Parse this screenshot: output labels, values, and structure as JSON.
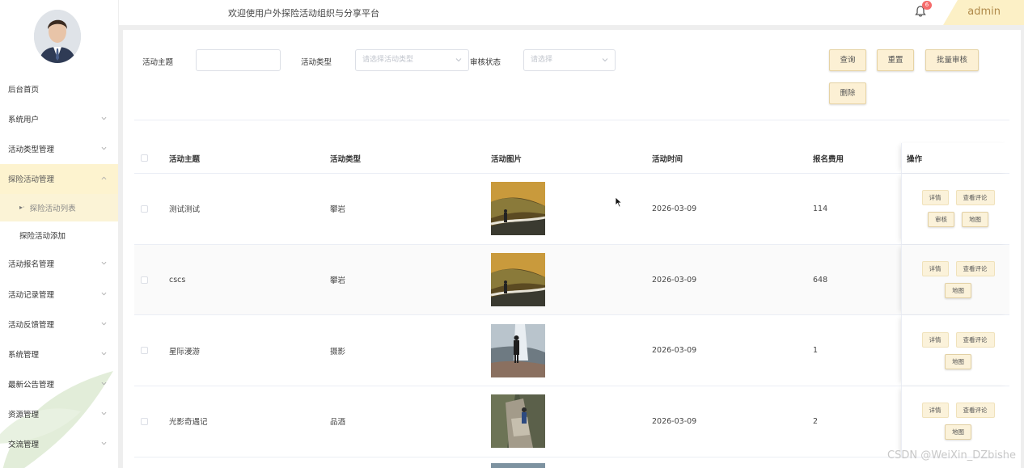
{
  "header": {
    "welcome": "欢迎使用户外探险活动组织与分享平台",
    "notification_count": "6",
    "username": "admin"
  },
  "sidebar": {
    "items": [
      {
        "label": "后台首页",
        "has_arrow": false
      },
      {
        "label": "系统用户",
        "has_arrow": true
      },
      {
        "label": "活动类型管理",
        "has_arrow": true
      },
      {
        "label": "探险活动管理",
        "has_arrow": true,
        "expanded": true
      },
      {
        "label": "活动报名管理",
        "has_arrow": true
      },
      {
        "label": "活动记录管理",
        "has_arrow": true
      },
      {
        "label": "活动反馈管理",
        "has_arrow": true
      },
      {
        "label": "系统管理",
        "has_arrow": true
      },
      {
        "label": "最新公告管理",
        "has_arrow": true
      },
      {
        "label": "资源管理",
        "has_arrow": true
      },
      {
        "label": "交流管理",
        "has_arrow": true
      }
    ],
    "subitems": [
      {
        "label": "探险活动列表",
        "active": true
      },
      {
        "label": "探险活动添加",
        "active": false
      }
    ]
  },
  "filters": {
    "topic_label": "活动主题",
    "topic_value": "",
    "type_label": "活动类型",
    "type_placeholder": "请选择活动类型",
    "status_label": "审核状态",
    "status_placeholder": "请选择"
  },
  "buttons": {
    "query": "查询",
    "reset": "重置",
    "batch_review": "批量审核",
    "delete": "删除"
  },
  "table": {
    "headers": {
      "title": "活动主题",
      "type": "活动类型",
      "image": "活动图片",
      "time": "活动时间",
      "fee": "报名费用",
      "ops": "操作"
    },
    "rows": [
      {
        "title": "测试测试",
        "type": "攀岩",
        "time": "2026-03-09",
        "fee": "114",
        "ops": [
          "详情",
          "查看评论",
          "审核",
          "地图"
        ],
        "image": "mountain-hiker"
      },
      {
        "title": "cscs",
        "type": "攀岩",
        "time": "2026-03-09",
        "fee": "648",
        "ops": [
          "详情",
          "查看评论",
          "地图"
        ],
        "image": "mountain-hiker"
      },
      {
        "title": "星际漫游",
        "type": "摄影",
        "time": "2026-03-09",
        "fee": "1",
        "ops": [
          "详情",
          "查看评论",
          "地图"
        ],
        "image": "waterfall-hiker"
      },
      {
        "title": "光影奇遇记",
        "type": "品酒",
        "time": "2026-03-09",
        "fee": "2",
        "ops": [
          "详情",
          "查看评论",
          "地图"
        ],
        "image": "rock-climber"
      }
    ]
  },
  "watermark": "CSDN @WeiXin_DZbishe"
}
